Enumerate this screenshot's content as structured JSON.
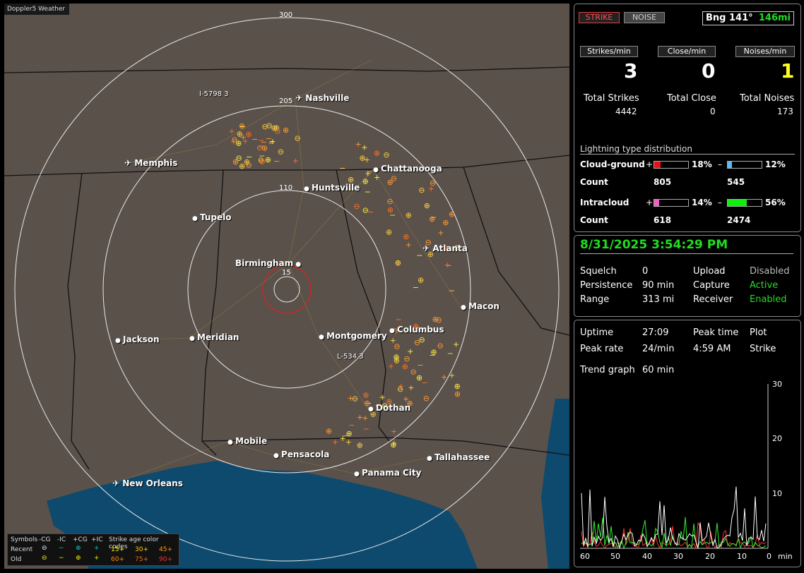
{
  "window_title": "Doppler5 Weather",
  "map": {
    "ring_labels": [
      "300",
      "205",
      "110",
      "15"
    ],
    "cities": [
      {
        "name": "Nashville",
        "x": 412,
        "y": 135,
        "type": "airport"
      },
      {
        "name": "Memphis",
        "x": 170,
        "y": 227,
        "type": "airport"
      },
      {
        "name": "Chattanooga",
        "x": 522,
        "y": 235,
        "type": "dot"
      },
      {
        "name": "Huntsville",
        "x": 424,
        "y": 262,
        "type": "dot"
      },
      {
        "name": "Tupelo",
        "x": 266,
        "y": 304,
        "type": "dot"
      },
      {
        "name": "Atlanta",
        "x": 592,
        "y": 348,
        "type": "airport"
      },
      {
        "name": "Birmingham",
        "x": 327,
        "y": 369,
        "type": "dot-right"
      },
      {
        "name": "Macon",
        "x": 646,
        "y": 430,
        "type": "dot"
      },
      {
        "name": "Columbus",
        "x": 545,
        "y": 463,
        "type": "dot"
      },
      {
        "name": "Montgomery",
        "x": 445,
        "y": 472,
        "type": "dot"
      },
      {
        "name": "Jackson",
        "x": 157,
        "y": 477,
        "type": "dot"
      },
      {
        "name": "Meridian",
        "x": 262,
        "y": 474,
        "type": "dot"
      },
      {
        "name": "Dothan",
        "x": 515,
        "y": 574,
        "type": "dot"
      },
      {
        "name": "Mobile",
        "x": 316,
        "y": 621,
        "type": "dot"
      },
      {
        "name": "Pensacola",
        "x": 381,
        "y": 640,
        "type": "dot"
      },
      {
        "name": "Tallahassee",
        "x": 598,
        "y": 644,
        "type": "dot"
      },
      {
        "name": "Panama City",
        "x": 495,
        "y": 666,
        "type": "dot"
      },
      {
        "name": "New Orleans",
        "x": 153,
        "y": 681,
        "type": "airport"
      }
    ],
    "track_labels": [
      {
        "text": "I-5798 3",
        "x": 282,
        "y": 133
      },
      {
        "text": "L-534 3",
        "x": 477,
        "y": 505
      }
    ],
    "legend": {
      "symbols_label": "Symbols",
      "cols": [
        "-CG",
        "-IC",
        "+CG",
        "+IC"
      ],
      "age_title": "Strike age color codes",
      "recent_label": "Recent",
      "old_label": "Old",
      "recent_codes": [
        "15+",
        "30+",
        "45+"
      ],
      "old_codes": [
        "60+",
        "75+",
        "90+"
      ]
    }
  },
  "top_panel": {
    "strike_btn": "STRIKE",
    "noise_btn": "NOISE",
    "bearing_label": "Bng 141°",
    "bearing_dist": "146mi",
    "rate_headers": [
      "Strikes/min",
      "Close/min",
      "Noises/min"
    ],
    "rates": [
      "3",
      "0",
      "1"
    ],
    "total_labels": [
      "Total Strikes",
      "Total Close",
      "Total Noises"
    ],
    "totals": [
      "4442",
      "0",
      "173"
    ],
    "dist_title": "Lightning type distribution",
    "cg_label": "Cloud-ground",
    "ic_label": "Intracloud",
    "count_label": "Count",
    "plus": "+",
    "minus": "–",
    "cg_pos_pct": "18%",
    "cg_neg_pct": "12%",
    "cg_pos_count": "805",
    "cg_neg_count": "545",
    "ic_pos_pct": "14%",
    "ic_neg_pct": "56%",
    "ic_pos_count": "618",
    "ic_neg_count": "2474",
    "fills": {
      "cg_pos": 0.18,
      "cg_neg": 0.12,
      "ic_pos": 0.14,
      "ic_neg": 0.56
    },
    "colors": {
      "cg_pos": "#e81010",
      "cg_neg": "#60b8f0",
      "ic_pos": "#f060c0",
      "ic_neg": "#10ee10"
    }
  },
  "status_panel": {
    "datetime": "8/31/2025 3:54:29 PM",
    "rows": [
      {
        "k1": "Squelch",
        "v1": "0",
        "k2": "Upload",
        "v2": "Disabled",
        "v2green": false
      },
      {
        "k1": "Persistence",
        "v1": "90 min",
        "k2": "Capture",
        "v2": "Active",
        "v2green": true
      },
      {
        "k1": "Range",
        "v1": "313 mi",
        "k2": "Receiver",
        "v2": "Enabled",
        "v2green": true
      }
    ]
  },
  "trend_panel": {
    "uptime_label": "Uptime",
    "uptime": "27:09",
    "peak_time_label": "Peak time",
    "peak_time": "4:59 AM",
    "plot_label": "Plot",
    "plot_value": "Strike",
    "peak_rate_label": "Peak rate",
    "peak_rate": "24/min",
    "trend_label": "Trend graph",
    "trend_value": "60 min",
    "y_ticks": [
      "30",
      "20",
      "10",
      "0"
    ],
    "x_ticks": [
      "60",
      "50",
      "40",
      "30",
      "20",
      "10",
      "0"
    ],
    "x_unit": "min"
  }
}
